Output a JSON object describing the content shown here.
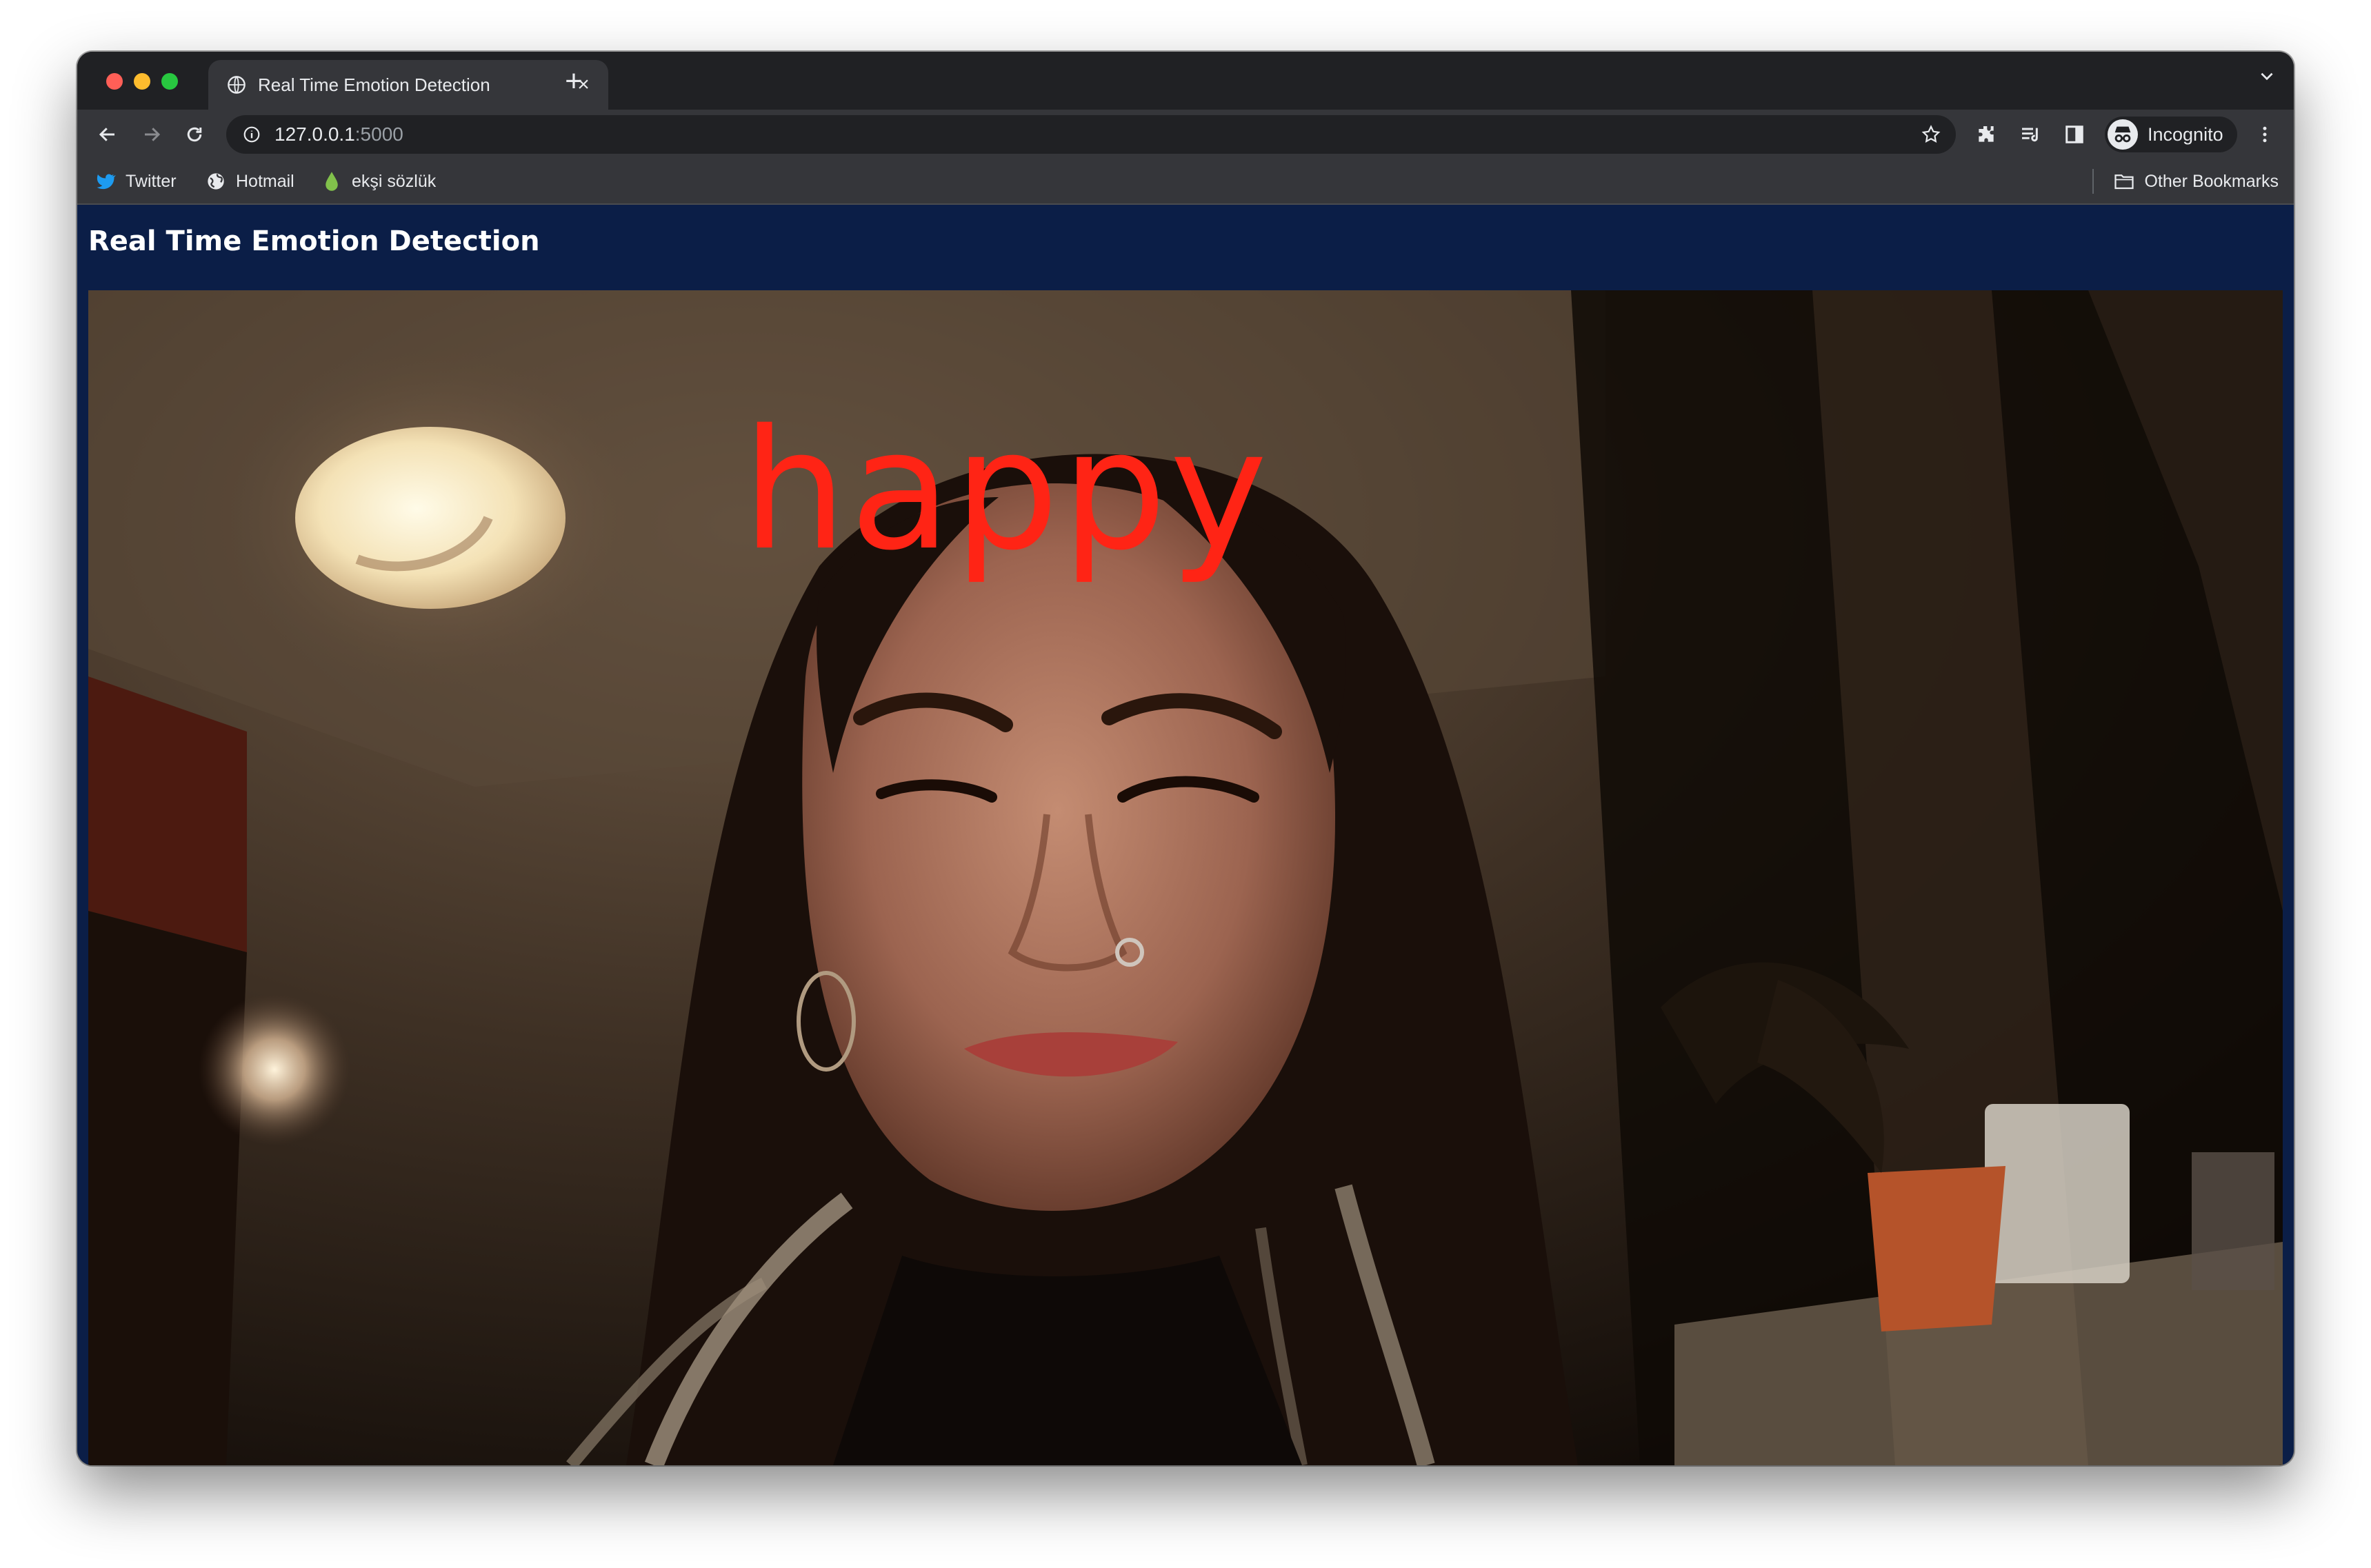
{
  "browser": {
    "tab_title": "Real Time Emotion Detection",
    "tab_close": "×",
    "new_tab": "+",
    "url_host": "127.0.0.1",
    "url_port": ":5000",
    "profile_label": "Incognito",
    "bookmarks": [
      {
        "label": "Twitter",
        "icon": "twitter-icon"
      },
      {
        "label": "Hotmail",
        "icon": "globe-icon"
      },
      {
        "label": "ekşi sözlük",
        "icon": "droplet-icon"
      }
    ],
    "other_bookmarks": "Other Bookmarks"
  },
  "page": {
    "title": "Real Time Emotion Detection",
    "header_color": "#0b1e47"
  },
  "video": {
    "emotion_label": "happy",
    "label_color": "#ff2415"
  }
}
